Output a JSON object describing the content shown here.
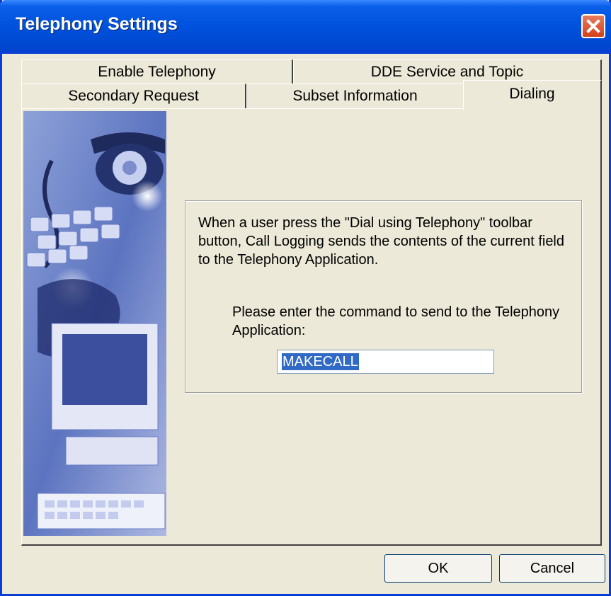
{
  "window": {
    "title": "Telephony Settings",
    "close_icon": "close-icon",
    "accent": "#0054e3",
    "close_color": "#d2421a"
  },
  "tabs": {
    "row_back": [
      {
        "label": "Enable Telephony"
      },
      {
        "label": "DDE Service and Topic"
      }
    ],
    "row_front": [
      {
        "label": "Secondary Request"
      },
      {
        "label": "Subset Information"
      },
      {
        "label": "Dialing"
      }
    ],
    "selected": "Dialing"
  },
  "panel": {
    "description": "When a user press the \"Dial using Telephony\" toolbar button, Call Logging sends the contents of the current field to the Telephony Application.",
    "prompt": "Please enter the command to send to the Telephony Application:",
    "command_value": "MAKECALL",
    "side_image": "telephone-keyboard-illustration"
  },
  "buttons": {
    "ok": "OK",
    "cancel": "Cancel"
  }
}
